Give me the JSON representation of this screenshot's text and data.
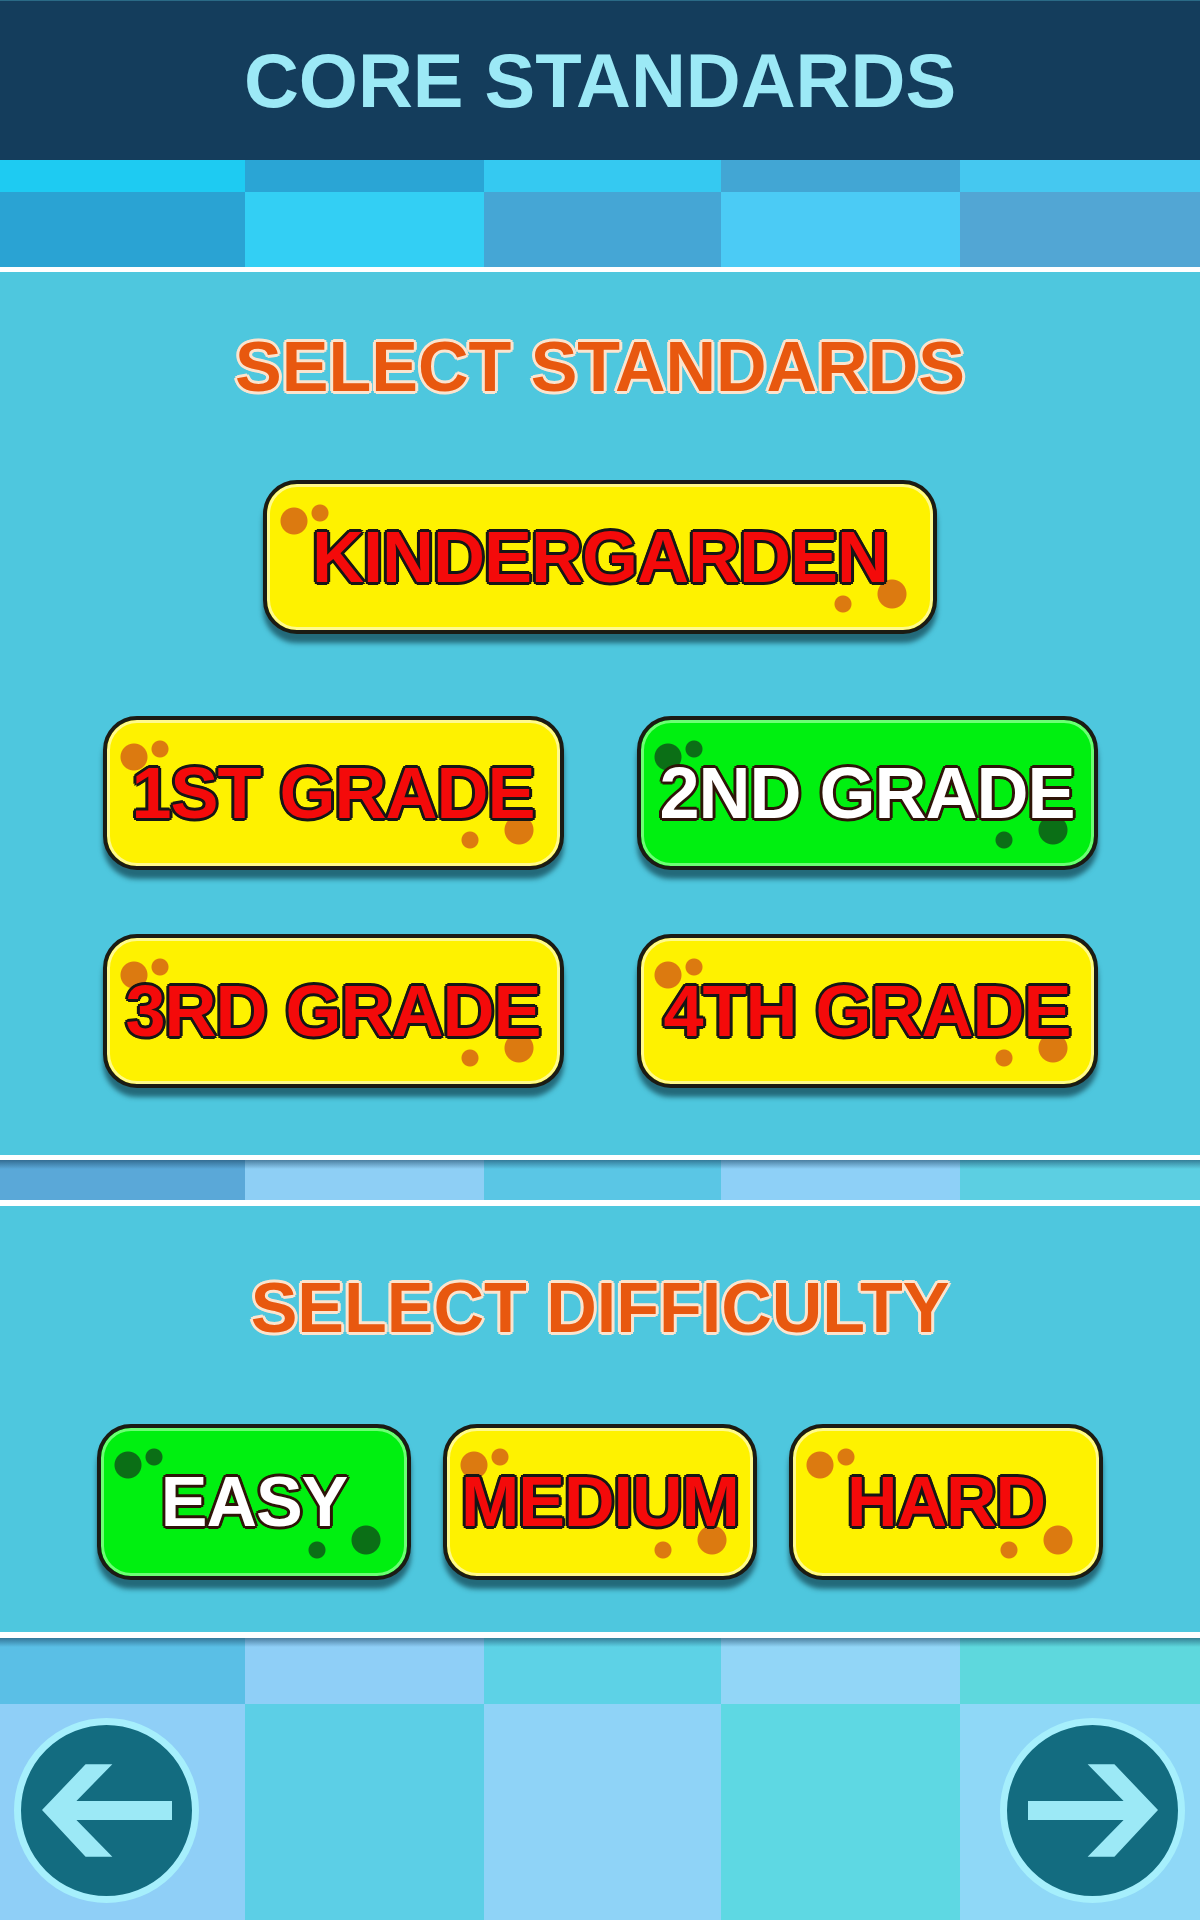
{
  "header": {
    "title": "CORE STANDARDS"
  },
  "standards": {
    "heading": "SELECT STANDARDS",
    "options": [
      {
        "label": "KINDERGARDEN",
        "selected": false
      },
      {
        "label": "1ST GRADE",
        "selected": false
      },
      {
        "label": "2ND GRADE",
        "selected": true
      },
      {
        "label": "3RD GRADE",
        "selected": false
      },
      {
        "label": "4TH GRADE",
        "selected": false
      }
    ]
  },
  "difficulty": {
    "heading": "SELECT DIFFICULTY",
    "options": [
      {
        "label": "EASY",
        "selected": true
      },
      {
        "label": "MEDIUM",
        "selected": false
      },
      {
        "label": "HARD",
        "selected": false
      }
    ]
  }
}
